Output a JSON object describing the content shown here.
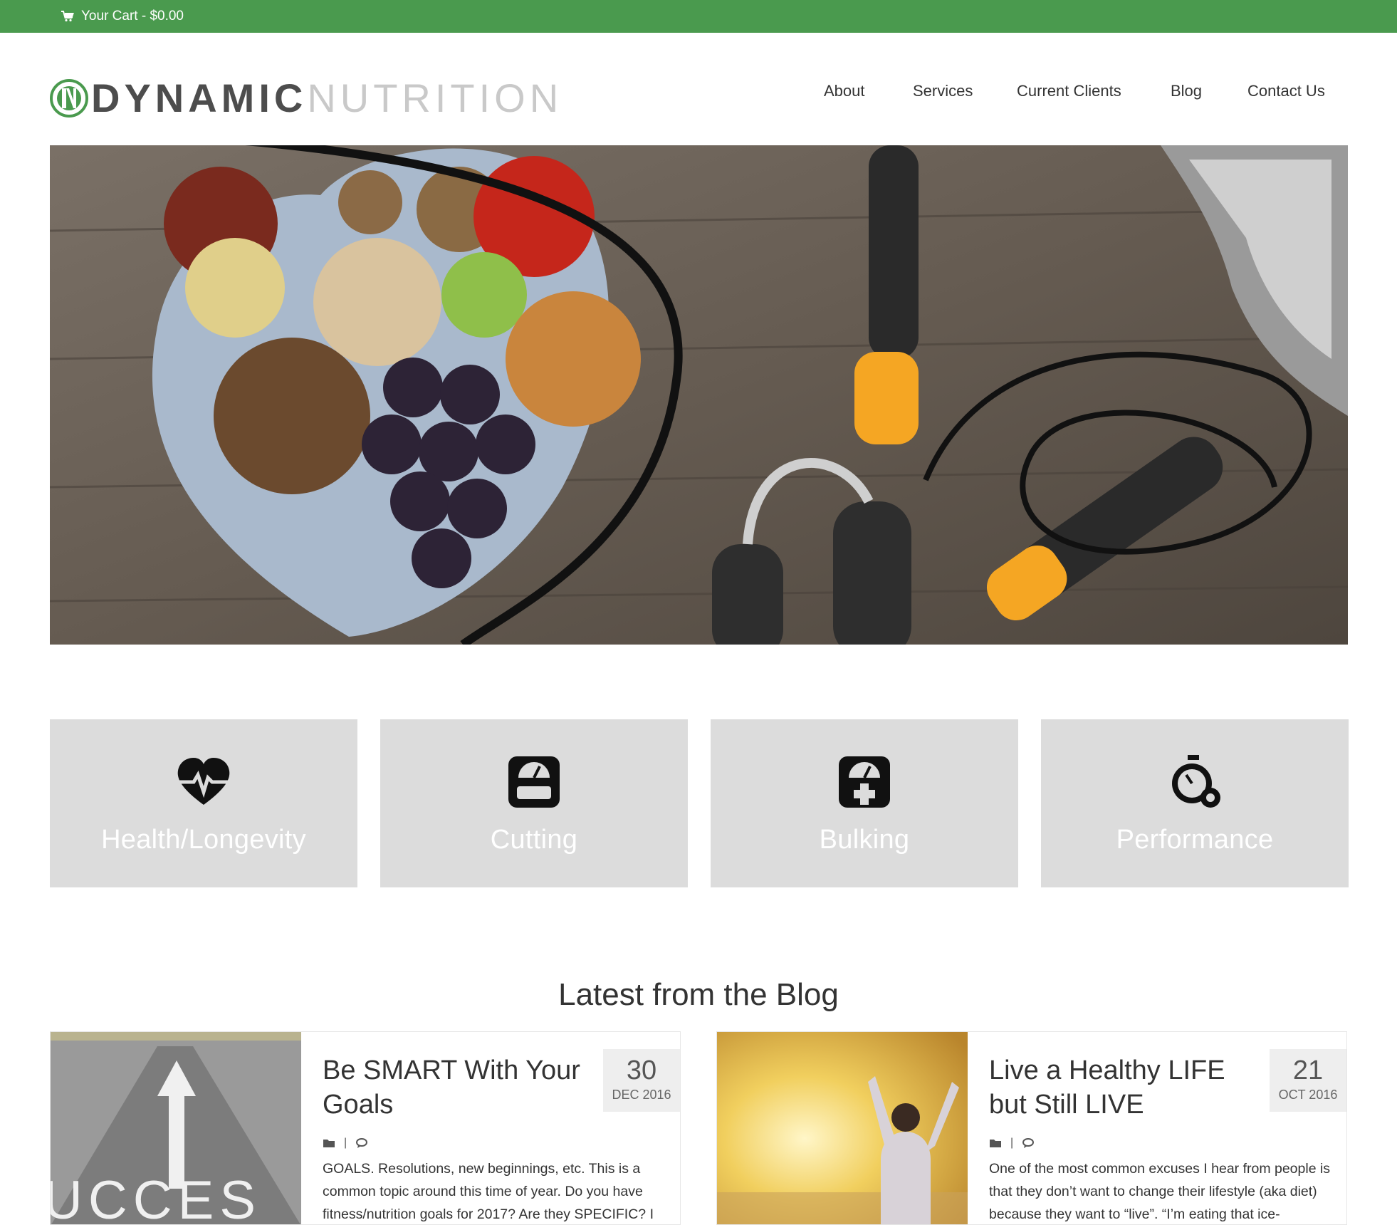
{
  "cart": {
    "label": "Your Cart - $0.00",
    "icon": "cart-icon"
  },
  "brand": {
    "part1": "DYNAMIC",
    "part2": "NUTRITION",
    "accent": "#4a9a4e"
  },
  "nav": [
    {
      "label": "About"
    },
    {
      "label": "Services"
    },
    {
      "label": "Current Clients"
    },
    {
      "label": "Blog"
    },
    {
      "label": "Contact Us"
    }
  ],
  "services": [
    {
      "label": "Health/Longevity",
      "icon": "heart-pulse-icon"
    },
    {
      "label": "Cutting",
      "icon": "scale-icon"
    },
    {
      "label": "Bulking",
      "icon": "scale-plus-icon"
    },
    {
      "label": "Performance",
      "icon": "stopwatch-gear-icon"
    }
  ],
  "blog": {
    "heading": "Latest from the Blog",
    "posts": [
      {
        "title": "Be SMART With Your Goals",
        "day": "30",
        "month": "DEC 2016",
        "thumb_text": "UCCES",
        "excerpt": "GOALS. Resolutions, new beginnings, etc. This is a common topic around this time of year. Do you have fitness/nutrition goals for 2017? Are they SPECIFIC? I"
      },
      {
        "title": "Live a Healthy LIFE but Still LIVE",
        "day": "21",
        "month": "OCT 2016",
        "excerpt": "One of the most common excuses I hear from people is that they don’t want to change their lifestyle (aka diet) because they want to “live”.   “I’m eating that ice-"
      }
    ]
  }
}
